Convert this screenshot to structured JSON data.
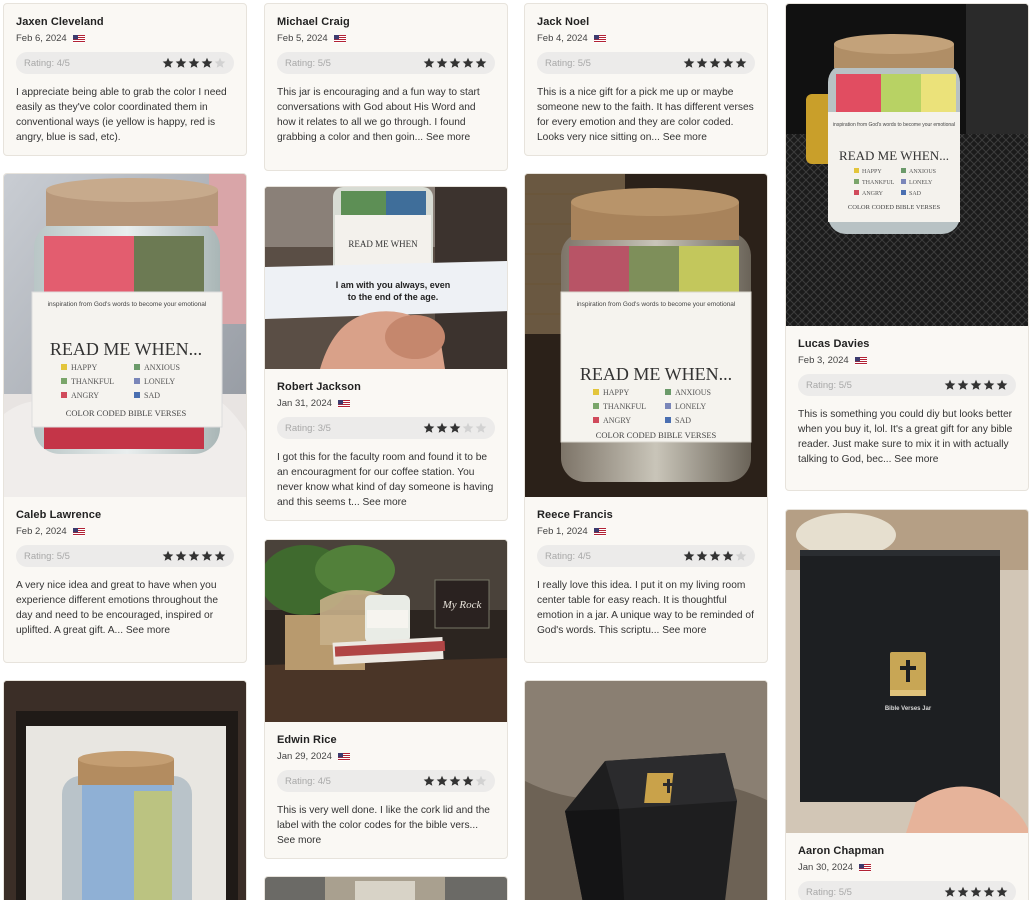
{
  "colors": {
    "star_filled": "#333333",
    "star_empty": "#d2d2d2",
    "card_bg": "#faf8f4"
  },
  "see_more": "See more",
  "col1": {
    "c1": {
      "name": "Jaxen Cleveland",
      "date": "Feb 6, 2024",
      "rating_label": "Rating: 4/5",
      "rating": 4,
      "text": "I appreciate being able to grab the color I need easily as they've color coordinated them in conventional ways (ie yellow is happy, red is angry, blue is sad, etc)."
    },
    "c2": {
      "name": "Caleb Lawrence",
      "date": "Feb 2, 2024",
      "rating_label": "Rating: 5/5",
      "rating": 5,
      "text": "A very nice idea and great to have when you experience different emotions throughout the day and need to be encouraged, inspired or uplifted. A great gift. A...",
      "photo": {
        "jar_title": "READ ME WHEN...",
        "arc_text": "inspiration from God's words to become your emotional",
        "items": [
          "HAPPY",
          "ANXIOUS",
          "THANKFUL",
          "LONELY",
          "ANGRY",
          "SAD"
        ],
        "footer": "COLOR CODED BIBLE VERSES"
      }
    }
  },
  "col2": {
    "c1": {
      "name": "Michael Craig",
      "date": "Feb 5, 2024",
      "rating_label": "Rating: 5/5",
      "rating": 5,
      "text": "This jar is encouraging and a fun way to start conversations with God about His Word and how it relates to all we go through. I found grabbing a color and then goin..."
    },
    "c2": {
      "name": "Robert Jackson",
      "date": "Jan 31, 2024",
      "rating_label": "Rating: 3/5",
      "rating": 3,
      "text": "I got this for the faculty room and found it to be an encouragment for our coffee station. You never know what kind of day someone is having and this seems t...",
      "photo": {
        "jar_title": "READ ME WHEN",
        "note_line1": "I am with you always, even",
        "note_line2": "to the end of the age."
      }
    },
    "c3": {
      "name": "Edwin Rice",
      "date": "Jan 29, 2024",
      "rating_label": "Rating: 4/5",
      "rating": 4,
      "text": "This is very well done. I like the cork lid and the label with the color codes for the bible vers...",
      "photo": {
        "sign_text": "My Rock"
      }
    }
  },
  "col3": {
    "c1": {
      "name": "Jack Noel",
      "date": "Feb 4, 2024",
      "rating_label": "Rating: 5/5",
      "rating": 5,
      "text": "This is a nice gift for a pick me up or maybe someone new to the faith. It has different verses for every emotion and they are color coded. Looks very nice sitting on..."
    },
    "c2": {
      "name": "Reece Francis",
      "date": "Feb 1, 2024",
      "rating_label": "Rating: 4/5",
      "rating": 4,
      "text": "I really love this idea. I put it on my living room center table for easy reach. It is thoughtful emotion in a jar. A unique way to be reminded of God's words. This scriptu...",
      "photo": {
        "jar_title": "READ ME WHEN...",
        "arc_text": "inspiration from God's words to become your emotional",
        "items": [
          "HAPPY",
          "ANXIOUS",
          "THANKFUL",
          "LONELY",
          "ANGRY",
          "SAD"
        ],
        "footer": "COLOR CODED BIBLE VERSES"
      }
    }
  },
  "col4": {
    "c1": {
      "name": "Lucas Davies",
      "date": "Feb 3, 2024",
      "rating_label": "Rating: 5/5",
      "rating": 5,
      "text": "This is something you could diy but looks better when you buy it, lol. It's a great gift for any bible reader. Just make sure to mix it in with actually talking to God, bec...",
      "photo": {
        "jar_title": "READ ME WHEN...",
        "arc_text": "inspiration from God's words to become your emotional",
        "items": [
          "HAPPY",
          "ANXIOUS",
          "THANKFUL",
          "LONELY",
          "ANGRY",
          "SAD"
        ],
        "footer": "COLOR CODED BIBLE VERSES"
      }
    },
    "c2": {
      "name": "Aaron Chapman",
      "date": "Jan 30, 2024",
      "rating_label": "Rating: 5/5",
      "rating": 5,
      "photo": {
        "box_caption": "Bible Verses Jar"
      }
    }
  }
}
